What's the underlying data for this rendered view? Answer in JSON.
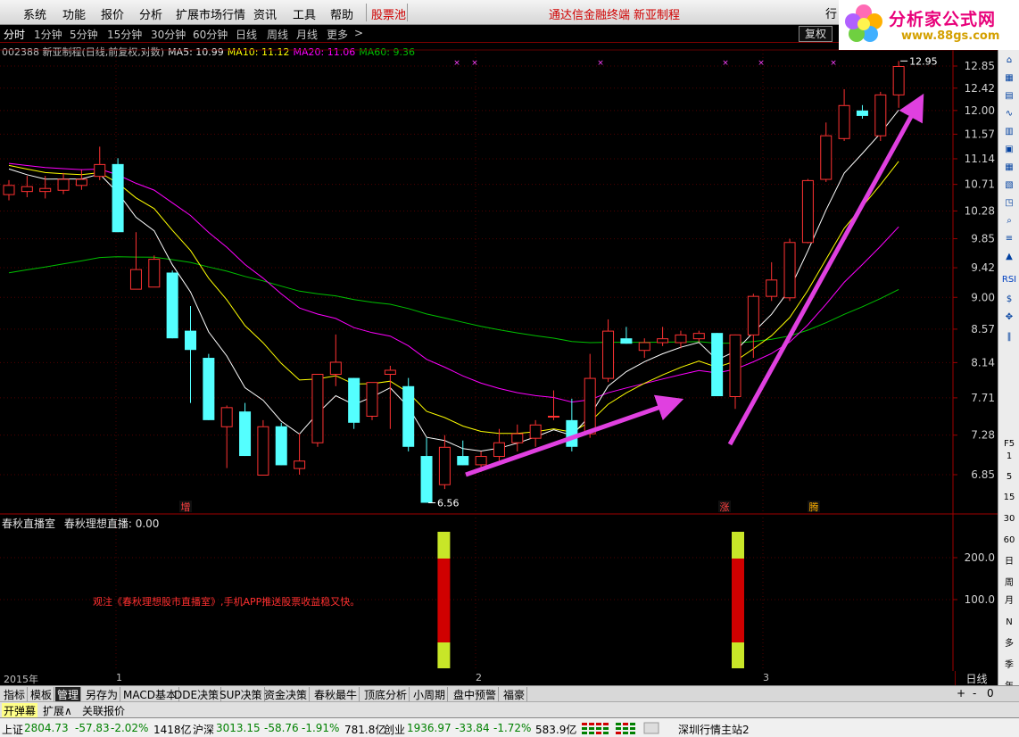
{
  "menu": {
    "items": [
      "系统",
      "功能",
      "报价",
      "分析",
      "扩展市场行情",
      "资讯",
      "工具",
      "帮助"
    ],
    "gupiaochi": "股票池",
    "title_center": "通达信金融终端",
    "title_stock": "新亚制程",
    "hang": "行"
  },
  "logo": {
    "text": "分析家公式网",
    "url": "www.88gs.com"
  },
  "periods": [
    "分时",
    "1分钟",
    "5分钟",
    "15分钟",
    "30分钟",
    "60分钟",
    "日线",
    "周线",
    "月线",
    "更多",
    ">"
  ],
  "fuquan": "复权",
  "info": {
    "stock": "002388 新亚制程(日线,前复权,对数)",
    "ma5": "MA5: 10.99",
    "ma10": "MA10: 11.12",
    "ma20": "MA20: 11.06",
    "ma60": "MA60: 9.36"
  },
  "colors": {
    "up": "#ff3232",
    "down": "#54ffff",
    "ma5": "#ffffff",
    "ma10": "#ffff00",
    "ma20": "#ff00ff",
    "ma60": "#00c000",
    "arrow": "#e040e0"
  },
  "chart_data": {
    "type": "candlestick",
    "y_ticks": [
      "12.85",
      "12.42",
      "12.00",
      "11.57",
      "11.14",
      "10.71",
      "10.28",
      "9.85",
      "9.42",
      "9.00",
      "8.57",
      "8.14",
      "7.71",
      "7.28",
      "6.85"
    ],
    "ylim": [
      6.56,
      12.95
    ],
    "high_label": "12.95",
    "low_label": "6.56",
    "candles": [
      {
        "o": 10.55,
        "h": 10.78,
        "l": 10.45,
        "c": 10.7
      },
      {
        "o": 10.6,
        "h": 10.85,
        "l": 10.5,
        "c": 10.68
      },
      {
        "o": 10.6,
        "h": 10.85,
        "l": 10.48,
        "c": 10.65
      },
      {
        "o": 10.62,
        "h": 10.9,
        "l": 10.55,
        "c": 10.8
      },
      {
        "o": 10.7,
        "h": 10.95,
        "l": 10.62,
        "c": 10.8
      },
      {
        "o": 10.85,
        "h": 11.35,
        "l": 10.78,
        "c": 11.05
      },
      {
        "o": 11.05,
        "h": 11.15,
        "l": 9.95,
        "c": 9.95
      },
      {
        "o": 9.12,
        "h": 9.95,
        "l": 9.12,
        "c": 9.4
      },
      {
        "o": 9.15,
        "h": 9.6,
        "l": 9.15,
        "c": 9.55
      },
      {
        "o": 9.35,
        "h": 9.38,
        "l": 8.45,
        "c": 8.45
      },
      {
        "o": 8.55,
        "h": 8.88,
        "l": 7.65,
        "c": 8.3
      },
      {
        "o": 8.2,
        "h": 8.25,
        "l": 7.45,
        "c": 7.45
      },
      {
        "o": 7.38,
        "h": 7.62,
        "l": 6.92,
        "c": 7.6
      },
      {
        "o": 7.55,
        "h": 7.65,
        "l": 7.05,
        "c": 7.05
      },
      {
        "o": 6.85,
        "h": 7.45,
        "l": 6.85,
        "c": 7.38
      },
      {
        "o": 7.38,
        "h": 7.42,
        "l": 6.95,
        "c": 6.95
      },
      {
        "o": 6.92,
        "h": 7.3,
        "l": 6.85,
        "c": 7.0
      },
      {
        "o": 7.2,
        "h": 8.0,
        "l": 7.15,
        "c": 8.0
      },
      {
        "o": 8.0,
        "h": 8.5,
        "l": 7.85,
        "c": 8.15
      },
      {
        "o": 7.95,
        "h": 7.95,
        "l": 7.35,
        "c": 7.42
      },
      {
        "o": 7.5,
        "h": 7.9,
        "l": 7.45,
        "c": 7.9
      },
      {
        "o": 8.0,
        "h": 8.1,
        "l": 7.35,
        "c": 8.05
      },
      {
        "o": 7.85,
        "h": 7.95,
        "l": 7.1,
        "c": 7.15
      },
      {
        "o": 7.05,
        "h": 7.25,
        "l": 6.56,
        "c": 6.56
      },
      {
        "o": 6.75,
        "h": 7.28,
        "l": 6.7,
        "c": 7.15
      },
      {
        "o": 7.05,
        "h": 7.22,
        "l": 6.95,
        "c": 6.95
      },
      {
        "o": 6.96,
        "h": 7.1,
        "l": 6.88,
        "c": 7.05
      },
      {
        "o": 7.05,
        "h": 7.35,
        "l": 7.0,
        "c": 7.2
      },
      {
        "o": 7.2,
        "h": 7.4,
        "l": 7.1,
        "c": 7.3
      },
      {
        "o": 7.25,
        "h": 7.45,
        "l": 7.15,
        "c": 7.4
      },
      {
        "o": 7.5,
        "h": 7.8,
        "l": 7.45,
        "c": 7.5
      },
      {
        "o": 7.45,
        "h": 7.7,
        "l": 7.1,
        "c": 7.15
      },
      {
        "o": 7.3,
        "h": 8.25,
        "l": 7.25,
        "c": 7.95
      },
      {
        "o": 7.95,
        "h": 8.7,
        "l": 7.9,
        "c": 8.55
      },
      {
        "o": 8.45,
        "h": 8.6,
        "l": 8.38,
        "c": 8.38
      },
      {
        "o": 8.3,
        "h": 8.45,
        "l": 8.2,
        "c": 8.4
      },
      {
        "o": 8.4,
        "h": 8.6,
        "l": 8.35,
        "c": 8.45
      },
      {
        "o": 8.4,
        "h": 8.55,
        "l": 8.32,
        "c": 8.5
      },
      {
        "o": 8.45,
        "h": 8.55,
        "l": 8.4,
        "c": 8.52
      },
      {
        "o": 8.52,
        "h": 8.52,
        "l": 7.73,
        "c": 7.73
      },
      {
        "o": 7.73,
        "h": 8.4,
        "l": 7.58,
        "c": 8.5
      },
      {
        "o": 8.5,
        "h": 9.05,
        "l": 8.2,
        "c": 9.02
      },
      {
        "o": 9.02,
        "h": 9.5,
        "l": 8.95,
        "c": 9.25
      },
      {
        "o": 9.0,
        "h": 9.85,
        "l": 8.95,
        "c": 9.8
      },
      {
        "o": 9.8,
        "h": 10.8,
        "l": 9.78,
        "c": 10.78
      },
      {
        "o": 10.8,
        "h": 11.78,
        "l": 10.75,
        "c": 11.55
      },
      {
        "o": 11.5,
        "h": 12.4,
        "l": 11.45,
        "c": 12.1
      },
      {
        "o": 12.0,
        "h": 12.1,
        "l": 11.85,
        "c": 11.9
      },
      {
        "o": 11.55,
        "h": 12.35,
        "l": 11.45,
        "c": 12.3
      },
      {
        "o": 12.3,
        "h": 12.95,
        "l": 12.05,
        "c": 12.85
      }
    ],
    "markers": {
      "zeng": 10,
      "zhang": 40,
      "ten": 45
    },
    "marker_text": {
      "zeng": "增",
      "zhang": "涨",
      "ten": "腾"
    },
    "indicator": {
      "name": "春秋直播室",
      "title": "春秋理想直播: 0.00",
      "y_ticks": [
        "200.0",
        "100.0"
      ],
      "bars_at": [
        24,
        40
      ]
    }
  },
  "promo": "观注《春秋理想股市直播室》,手机APP推送股票收益稳又快。",
  "axis": {
    "year": "2015年",
    "months": [
      "1",
      "2",
      "3"
    ],
    "period_label": "日线"
  },
  "tabs": [
    "指标",
    "模板",
    "管理",
    "另存为",
    "MACD基本",
    "DDE决策",
    "SUP决策",
    "资金决策",
    "春秋最牛",
    "顶底分析",
    "小周期",
    "盘中预警",
    "福豪"
  ],
  "tab_controls": [
    "+",
    "-",
    "0"
  ],
  "toolrow": [
    "开弹幕",
    "扩展∧",
    "关联报价"
  ],
  "status": {
    "sh_label": "上证",
    "sh_val": "2804.73",
    "sh_chg": "-57.83",
    "sh_pct": "-2.02%",
    "sh_amt": "1418亿",
    "hs_label": "沪深",
    "hs_val": "3013.15",
    "hs_chg": "-58.76",
    "hs_pct": "-1.91%",
    "hs_amt": "781.8亿",
    "cy_label": "创业",
    "cy_val": "1936.97",
    "cy_chg": "-33.84",
    "cy_pct": "-1.72%",
    "cy_amt": "583.9亿",
    "server": "深圳行情主站2"
  },
  "right_tools": [
    "Fio",
    "RSI",
    "F5",
    "1",
    "5",
    "15",
    "30",
    "60",
    "日",
    "周",
    "月",
    "N",
    "多",
    "季",
    "年"
  ]
}
